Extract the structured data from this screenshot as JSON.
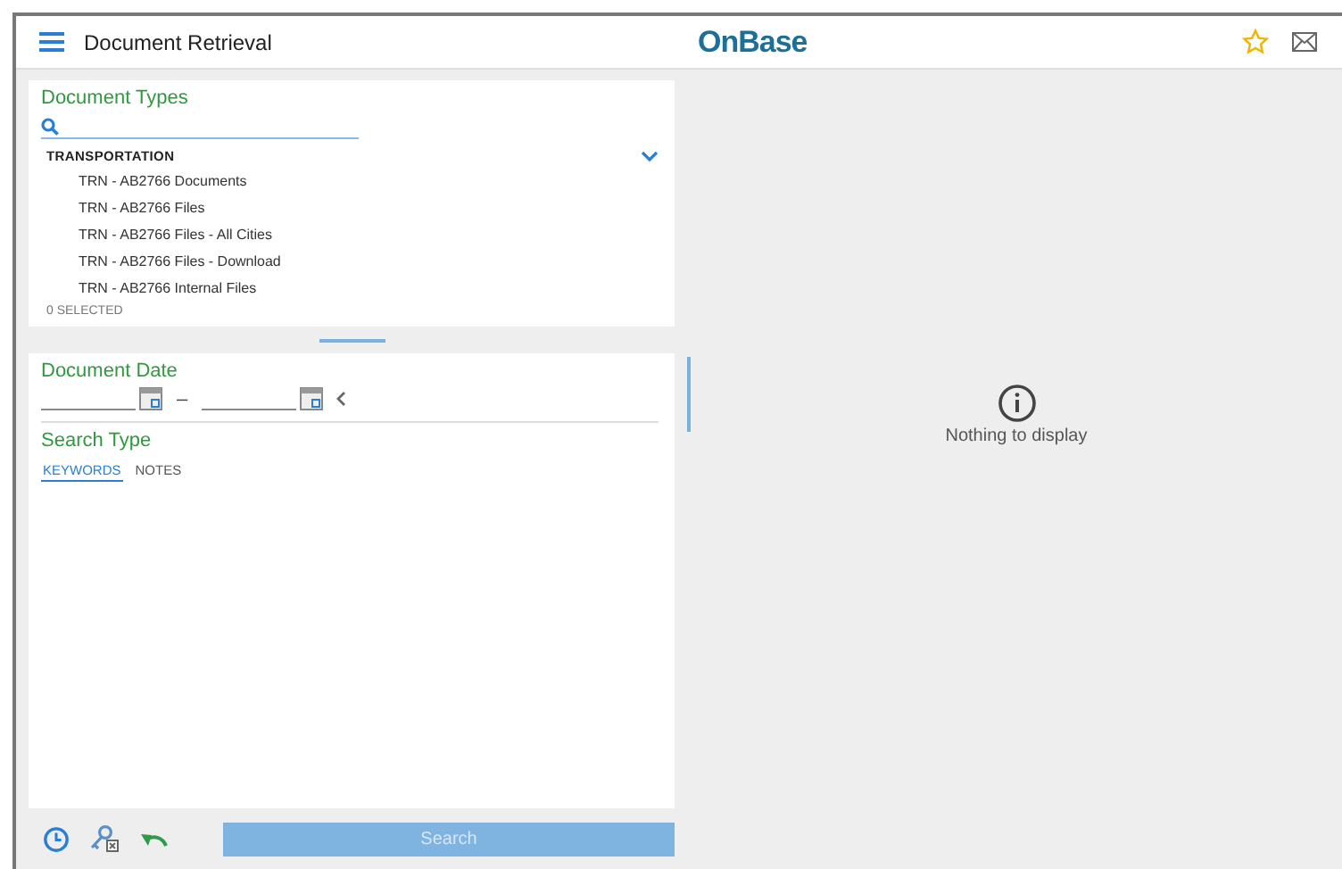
{
  "header": {
    "title": "Document Retrieval",
    "logo": "OnBase"
  },
  "document_types": {
    "title": "Document Types",
    "group": {
      "label": "TRANSPORTATION",
      "expanded": true,
      "items": [
        "TRN - AB2766 Documents",
        "TRN - AB2766 Files",
        "TRN - AB2766 Files - All Cities",
        "TRN - AB2766 Files - Download",
        "TRN - AB2766 Internal Files"
      ]
    },
    "selected_count": "0 SELECTED"
  },
  "document_date": {
    "title": "Document Date",
    "separator": "–"
  },
  "search_type": {
    "title": "Search Type",
    "tabs": [
      {
        "label": "KEYWORDS",
        "selected": true
      },
      {
        "label": "NOTES",
        "selected": false
      }
    ]
  },
  "results": {
    "message": "Nothing to display"
  },
  "footer": {
    "search_button": "Search",
    "search_disabled": true
  }
}
